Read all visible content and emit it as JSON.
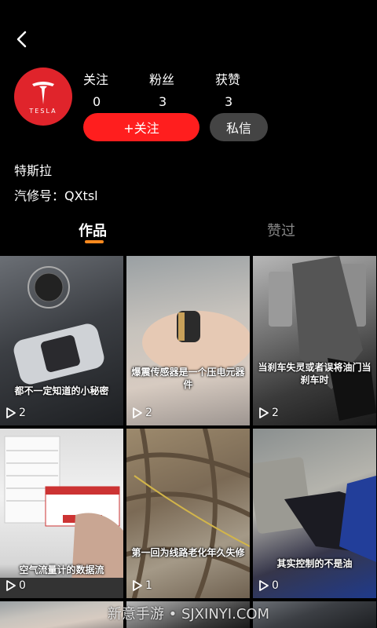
{
  "profile": {
    "avatar_brand": "TESLA",
    "stats": [
      {
        "label": "关注",
        "value": "0"
      },
      {
        "label": "粉丝",
        "value": "3"
      },
      {
        "label": "获赞",
        "value": "3"
      }
    ],
    "follow_label": "+关注",
    "message_label": "私信",
    "name": "特斯拉",
    "id_line": "汽修号：QXtsl"
  },
  "tabs": [
    {
      "label": "作品",
      "active": true
    },
    {
      "label": "赞过",
      "active": false
    }
  ],
  "videos": [
    {
      "caption": "都不一定知道的小秘密",
      "plays": "2"
    },
    {
      "caption": "爆震传感器是一个压电元器件",
      "plays": "2"
    },
    {
      "caption": "当刹车失灵或者误将油门当刹车时",
      "plays": "2"
    },
    {
      "caption": "空气流量计的数据流",
      "plays": "0"
    },
    {
      "caption": "第一回为线路老化年久失修",
      "plays": "1"
    },
    {
      "caption": "其实控制的不是油",
      "plays": "0"
    }
  ],
  "watermark": "新意手游 • SJXINYI.COM",
  "colors": {
    "accent": "#ff1e1e",
    "tab_indicator": "#ff8a1e",
    "avatar_bg": "#e0242b"
  }
}
